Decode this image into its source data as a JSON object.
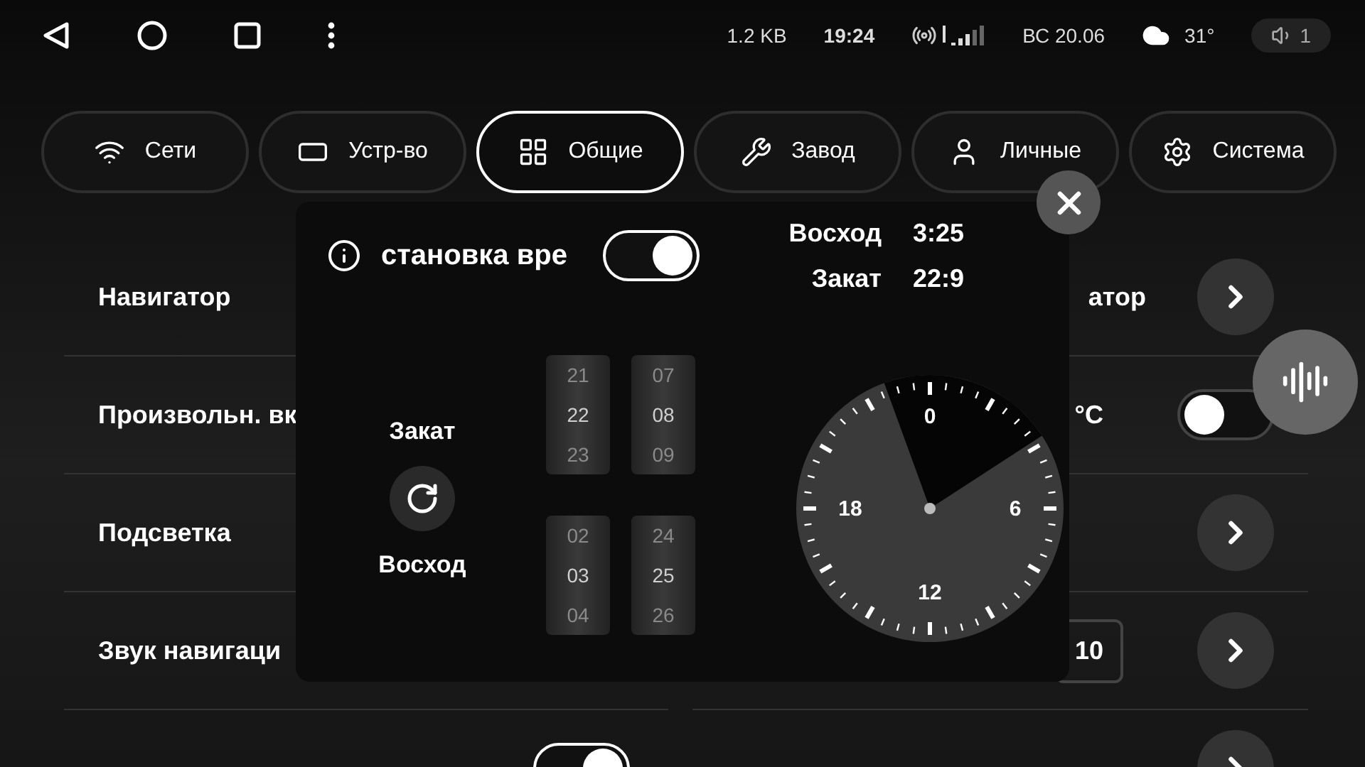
{
  "status_bar": {
    "data_rate": "1.2 KB",
    "time": "19:24",
    "date": "ВС 20.06",
    "temperature": "31°",
    "volume": "1"
  },
  "tabs": [
    {
      "label": "Сети",
      "selected": false
    },
    {
      "label": "Устр-во",
      "selected": false
    },
    {
      "label": "Общие",
      "selected": true
    },
    {
      "label": "Завод",
      "selected": false
    },
    {
      "label": "Личные",
      "selected": false
    },
    {
      "label": "Система",
      "selected": false
    }
  ],
  "rows": [
    {
      "left": "Навигатор",
      "right_text": "атор",
      "kind": "chevron"
    },
    {
      "left": "Произвольн. вк",
      "right_text": "°C",
      "kind": "toggle",
      "on": false
    },
    {
      "left": "Подсветка",
      "kind": "chevron"
    },
    {
      "left": "Звук навигаци",
      "right_text": "10",
      "kind": "value"
    },
    {
      "left_toggle_on": true,
      "kind": "chevron"
    }
  ],
  "dialog": {
    "title": "становка вре",
    "enabled": true,
    "sun_times": [
      {
        "label": "Восход",
        "time": "3:25"
      },
      {
        "label": "Закат",
        "time": "22:9"
      }
    ],
    "pickers": [
      {
        "label": "Закат",
        "hours": [
          {
            "value": "21",
            "selected": false
          },
          {
            "value": "22",
            "selected": true
          },
          {
            "value": "23",
            "selected": false
          }
        ],
        "minutes": [
          {
            "value": "07",
            "selected": false
          },
          {
            "value": "08",
            "selected": true
          },
          {
            "value": "09",
            "selected": false
          }
        ]
      },
      {
        "label": "Восход",
        "hours": [
          {
            "value": "02",
            "selected": false
          },
          {
            "value": "03",
            "selected": true
          },
          {
            "value": "04",
            "selected": false
          }
        ],
        "minutes": [
          {
            "value": "24",
            "selected": false
          },
          {
            "value": "25",
            "selected": true
          },
          {
            "value": "26",
            "selected": false
          }
        ]
      }
    ],
    "dial_labels": [
      "0",
      "6",
      "12",
      "18"
    ]
  }
}
